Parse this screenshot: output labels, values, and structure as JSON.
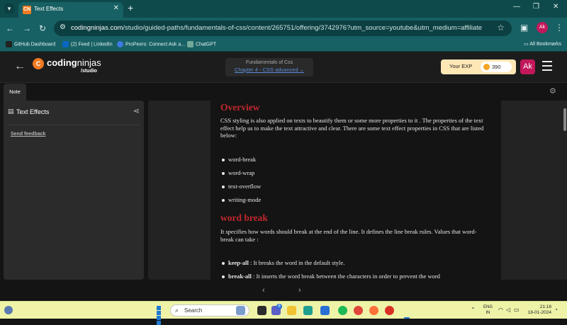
{
  "browser": {
    "tab_title": "Text Effects",
    "tab_close": "✕",
    "new_tab": "+",
    "url_host": "codingninjas.com",
    "url_path": "/studio/guided-paths/fundamentals-of-css/content/265751/offering/3742976?utm_source=youtube&utm_medium=affiliate&utm_ca...",
    "profile_initials": "Ak",
    "bookmarks": [
      {
        "label": "GitHub Dashboard",
        "color": "#222222"
      },
      {
        "label": "(2) Feed | LinkedIn",
        "color": "#0a66c2"
      },
      {
        "label": "ProPeers: Connect Ask a...",
        "color": "#3d7ae0"
      },
      {
        "label": "ChatGPT",
        "color": "#74aa9c"
      }
    ],
    "all_bookmarks": "All Bookmarks"
  },
  "site": {
    "logo_text_bold": "coding",
    "logo_text_light": "ninjas",
    "logo_sub": "/studio",
    "course_title": "Fundamentals of Css",
    "chapter": "Chapter 4 - CSS advanced",
    "exp_label": "Your EXP",
    "exp_value": "390",
    "user_initials": "Ak"
  },
  "note_tab": "Note",
  "left_panel": {
    "title": "Text Effects",
    "feedback": "Send feedback"
  },
  "article": {
    "h_overview": "Overview",
    "p_overview": "CSS styling is also applied on texts to beautify them or some more properties to it . The properties of the text effect help us to make the text attractive and clear. There are some text effect properties in CSS that are listed below:",
    "properties": [
      "word-break",
      "word-wrap",
      "text-overflow",
      "writing-mode"
    ],
    "h_word_break": "word break",
    "p_word_break": "It specifies how words should break at the end of the line. It defines the line break rules. Values that word-break can take :",
    "values": [
      {
        "term": "keep-all",
        "sep": " :  ",
        "desc": "It breaks the word in the default style."
      },
      {
        "term": "break-all",
        "sep": " : ",
        "desc": "It inserts the word break between the characters in order to prevent the word"
      }
    ]
  },
  "taskbar": {
    "search_label": "Search",
    "lang_top": "ENG",
    "lang_bottom": "IN",
    "time": "21:18",
    "date": "18-01-2024",
    "badge": "6",
    "apps": [
      {
        "name": "file-manager",
        "color": "#7a9ccf"
      },
      {
        "name": "task-view",
        "color": "#2b2b2b"
      },
      {
        "name": "teams",
        "color": "#5b5fc7"
      },
      {
        "name": "explorer",
        "color": "#f1c232"
      },
      {
        "name": "edge",
        "color": "#1e9e8e"
      },
      {
        "name": "store",
        "color": "#2a6fd6"
      },
      {
        "name": "spotify",
        "color": "#1db954"
      },
      {
        "name": "music",
        "color": "#e0453a"
      },
      {
        "name": "firefox",
        "color": "#ff7139"
      },
      {
        "name": "chrome",
        "color": "#d93025"
      }
    ]
  }
}
